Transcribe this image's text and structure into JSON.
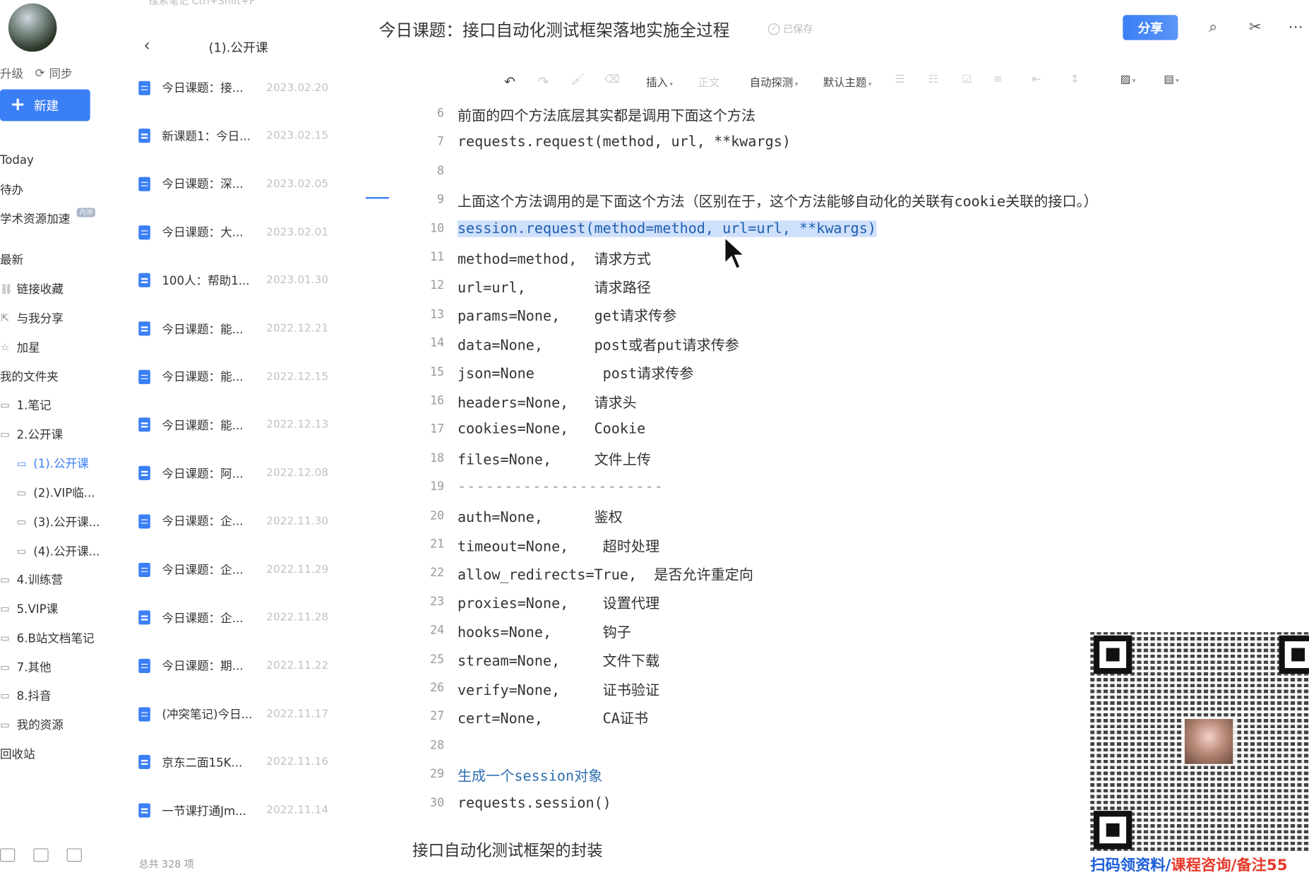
{
  "sidebar": {
    "upgrade_label": "升级",
    "sync_label": "同步",
    "new_label": "新建",
    "items": [
      {
        "label": "Today",
        "icon": "none",
        "badge": ""
      },
      {
        "label": "待办",
        "icon": "none",
        "badge": ""
      },
      {
        "label": "学术资源加速",
        "icon": "none",
        "badge": "内测"
      },
      {
        "label": "最新",
        "icon": "none",
        "badge": ""
      },
      {
        "label": "链接收藏",
        "icon": "link-icon",
        "badge": ""
      },
      {
        "label": "与我分享",
        "icon": "share-icon",
        "badge": ""
      },
      {
        "label": "加星",
        "icon": "star-icon",
        "badge": ""
      },
      {
        "label": "我的文件夹",
        "icon": "none",
        "badge": ""
      },
      {
        "label": "1.笔记",
        "icon": "folder-icon",
        "badge": ""
      },
      {
        "label": "2.公开课",
        "icon": "folder-icon",
        "badge": ""
      },
      {
        "label": "(1).公开课",
        "icon": "folder-icon",
        "badge": ""
      },
      {
        "label": "(2).VIP临...",
        "icon": "folder-icon",
        "badge": ""
      },
      {
        "label": "(3).公开课...",
        "icon": "folder-icon",
        "badge": ""
      },
      {
        "label": "(4).公开课...",
        "icon": "folder-icon",
        "badge": ""
      },
      {
        "label": "4.训练营",
        "icon": "folder-icon",
        "badge": ""
      },
      {
        "label": "5.VIP课",
        "icon": "folder-icon",
        "badge": ""
      },
      {
        "label": "6.B站文档笔记",
        "icon": "folder-icon",
        "badge": ""
      },
      {
        "label": "7.其他",
        "icon": "folder-icon",
        "badge": ""
      },
      {
        "label": "8.抖音",
        "icon": "folder-icon",
        "badge": ""
      },
      {
        "label": "我的资源",
        "icon": "folder-icon",
        "badge": ""
      },
      {
        "label": "回收站",
        "icon": "none",
        "badge": ""
      }
    ]
  },
  "notelist": {
    "search_placeholder": "搜索笔记 Ctrl+Shift+F",
    "folder_title": "(1).公开课",
    "total": "总共 328 项",
    "notes": [
      {
        "title": "今日课题：接...",
        "date": "2023.02.20"
      },
      {
        "title": "新课题1：今日...",
        "date": "2023.02.15"
      },
      {
        "title": "今日课题：深...",
        "date": "2023.02.05"
      },
      {
        "title": "今日课题：大...",
        "date": "2023.02.01"
      },
      {
        "title": "100人：帮助1...",
        "date": "2023.01.30"
      },
      {
        "title": "今日课题：能...",
        "date": "2022.12.21"
      },
      {
        "title": "今日课题：能...",
        "date": "2022.12.15"
      },
      {
        "title": "今日课题：能...",
        "date": "2022.12.13"
      },
      {
        "title": "今日课题：阿...",
        "date": "2022.12.08"
      },
      {
        "title": "今日课题：企...",
        "date": "2022.11.30"
      },
      {
        "title": "今日课题：企...",
        "date": "2022.11.29"
      },
      {
        "title": "今日课题：企...",
        "date": "2022.11.28"
      },
      {
        "title": "今日课题：期...",
        "date": "2022.11.22"
      },
      {
        "title": "(冲突笔记)今日...",
        "date": "2022.11.17"
      },
      {
        "title": "京东二面15K...",
        "date": "2022.11.16"
      },
      {
        "title": "一节课打通Jm...",
        "date": "2022.11.14"
      }
    ]
  },
  "editor": {
    "title": "今日课题：接口自动化测试框架落地实施全过程",
    "saved_label": "已保存",
    "share_label": "分享",
    "toolbar": {
      "insert": "插入",
      "body_text": "正文",
      "auto_detect": "自动探测",
      "default_theme": "默认主题"
    },
    "code_lines": [
      {
        "n": "6",
        "text": "前面的四个方法底层其实都是调用下面这个方法",
        "style": ""
      },
      {
        "n": "7",
        "text": "requests.request(method, url, **kwargs)",
        "style": ""
      },
      {
        "n": "8",
        "text": "",
        "style": ""
      },
      {
        "n": "9",
        "text": "上面这个方法调用的是下面这个方法（区别在于，这个方法能够自动化的关联有cookie关联的接口。）",
        "style": ""
      },
      {
        "n": "10",
        "text": "session.request(method=method, url=url, **kwargs)",
        "style": "sel"
      },
      {
        "n": "11",
        "text": "method=method,  请求方式",
        "style": ""
      },
      {
        "n": "12",
        "text": "url=url,        请求路径",
        "style": ""
      },
      {
        "n": "13",
        "text": "params=None,    get请求传参",
        "style": ""
      },
      {
        "n": "14",
        "text": "data=None,      post或者put请求传参",
        "style": ""
      },
      {
        "n": "15",
        "text": "json=None        post请求传参",
        "style": ""
      },
      {
        "n": "16",
        "text": "headers=None,   请求头",
        "style": ""
      },
      {
        "n": "17",
        "text": "cookies=None,   Cookie",
        "style": ""
      },
      {
        "n": "18",
        "text": "files=None,     文件上传",
        "style": ""
      },
      {
        "n": "19",
        "text": "----------------------",
        "style": "dash"
      },
      {
        "n": "20",
        "text": "auth=None,      鉴权",
        "style": ""
      },
      {
        "n": "21",
        "text": "timeout=None,    超时处理",
        "style": ""
      },
      {
        "n": "22",
        "text": "allow_redirects=True,  是否允许重定向",
        "style": ""
      },
      {
        "n": "23",
        "text": "proxies=None,    设置代理",
        "style": ""
      },
      {
        "n": "24",
        "text": "hooks=None,      钩子",
        "style": ""
      },
      {
        "n": "25",
        "text": "stream=None,     文件下载",
        "style": ""
      },
      {
        "n": "26",
        "text": "verify=None,     证书验证",
        "style": ""
      },
      {
        "n": "27",
        "text": "cert=None,       CA证书",
        "style": ""
      },
      {
        "n": "28",
        "text": "",
        "style": ""
      },
      {
        "n": "29",
        "text": "生成一个session对象",
        "style": "blue"
      },
      {
        "n": "30",
        "text": "requests.session()",
        "style": ""
      }
    ],
    "footer_text": "接口自动化测试框架的封装"
  },
  "overlay": {
    "caption_part1": "扫码领资料/",
    "caption_part2": "课程咨询/备注55"
  },
  "colors": {
    "accent": "#3a7ff5",
    "selection": "#cfe0fb",
    "caption_blue": "#1a5dd9",
    "caption_red": "#e53a2c"
  }
}
